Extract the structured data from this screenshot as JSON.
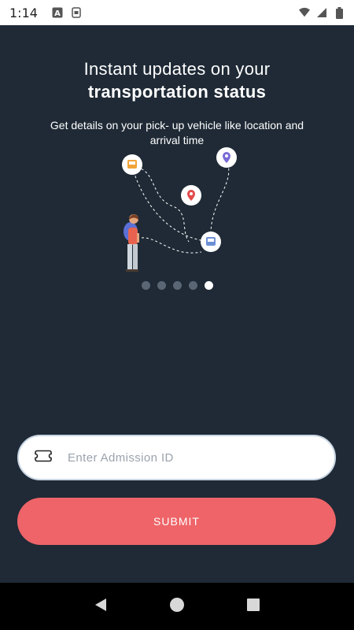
{
  "status_bar": {
    "time": "1:14",
    "icons": [
      "keyboard-a-icon",
      "sim-icon",
      "wifi-icon",
      "signal-icon",
      "battery-icon"
    ]
  },
  "onboarding": {
    "title_line1": "Instant updates on your",
    "title_line2": "transportation status",
    "subtitle": "Get details on your pick- up vehicle like location and arrival time",
    "page_count": 5,
    "active_page": 5
  },
  "form": {
    "admission_placeholder": "Enter Admission ID",
    "admission_value": "",
    "submit_label": "SUBMIT"
  },
  "nav": {
    "buttons": [
      "back-icon",
      "home-icon",
      "recents-icon"
    ]
  },
  "colors": {
    "background": "#1f2a36",
    "accent": "#ee6468",
    "dot_inactive": "#5b6675",
    "dot_active": "#ffffff"
  }
}
